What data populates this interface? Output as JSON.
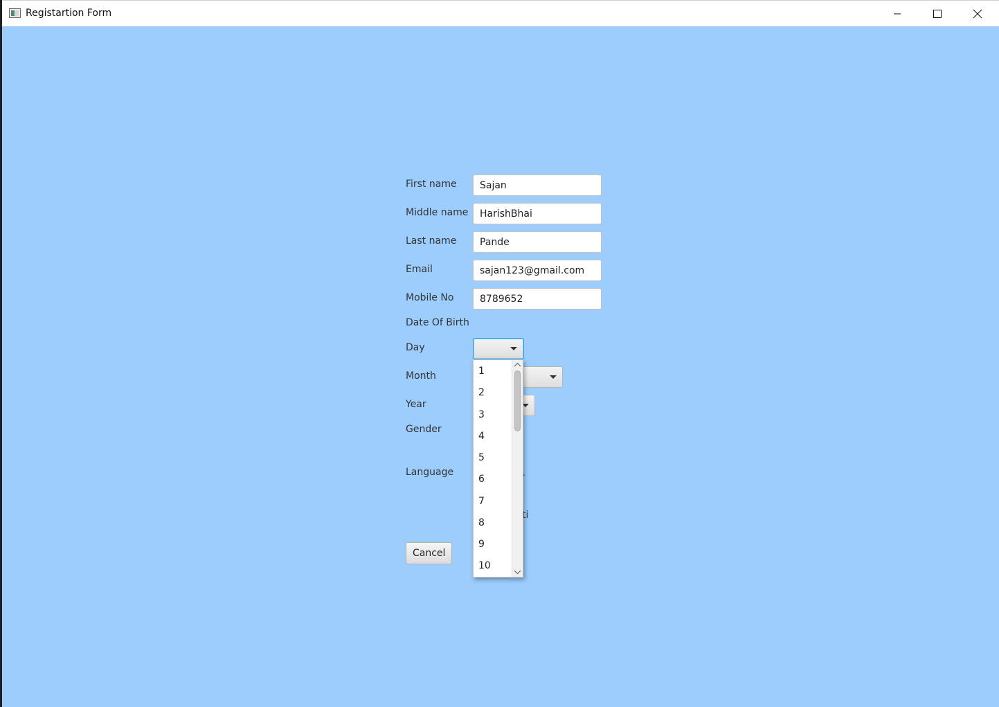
{
  "window": {
    "title": "Registartion Form",
    "controls": [
      "minimize-icon",
      "maximize-icon",
      "close-icon"
    ]
  },
  "form": {
    "first_name": {
      "label": "First name",
      "value": "Sajan"
    },
    "middle_name": {
      "label": "Middle name",
      "value": "HarishBhai"
    },
    "last_name": {
      "label": "Last name",
      "value": "Pande"
    },
    "email": {
      "label": "Email",
      "value": "sajan123@gmail.com"
    },
    "mobile": {
      "label": "Mobile No",
      "value": "8789652"
    },
    "dob_heading": "Date Of Birth",
    "day": {
      "label": "Day",
      "value": ""
    },
    "month": {
      "label": "Month",
      "value": ""
    },
    "year": {
      "label": "Year",
      "value": ""
    },
    "gender": {
      "label": "Gender"
    },
    "language": {
      "label": "Language"
    },
    "cancel_label": "Cancel"
  },
  "day_dropdown": {
    "options": [
      "1",
      "2",
      "3",
      "4",
      "5",
      "6",
      "7",
      "8",
      "9",
      "10"
    ]
  },
  "colors": {
    "background": "#9ccdfd",
    "focus": "#2e9bd6"
  }
}
